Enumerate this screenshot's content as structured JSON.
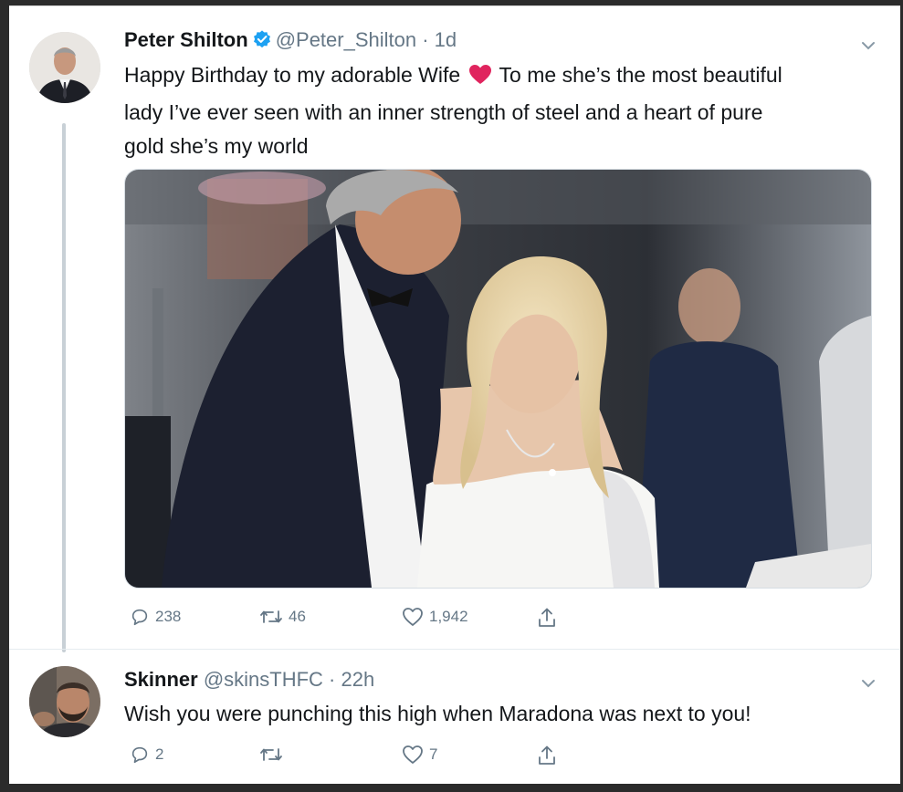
{
  "tweet1": {
    "name": "Peter Shilton",
    "handle_time": "@Peter_Shilton · 1d",
    "text_line1_a": "Happy Birthday to my adorable Wife",
    "text_line1_b": "To me she’s the most beautiful",
    "text_line2": "lady I’ve ever seen with an inner strength of steel and a heart of pure",
    "text_line3": "gold she’s my world",
    "replies": "238",
    "retweets": "46",
    "likes": "1,942",
    "icons": [
      "verified-badge-icon",
      "red-heart-emoji",
      "chevron-down-icon",
      "reply-icon",
      "retweet-icon",
      "like-icon",
      "share-icon"
    ]
  },
  "tweet2": {
    "name": "Skinner",
    "handle_time": "@skinsTHFC · 22h",
    "text": "Wish you were punching this high when Maradona was next to you!",
    "replies": "2",
    "retweets": "",
    "likes": "7"
  },
  "colors": {
    "verified": "#1da1f2",
    "text": "#14171a",
    "secondary": "#657786",
    "heart_emoji": "#e0245e"
  }
}
